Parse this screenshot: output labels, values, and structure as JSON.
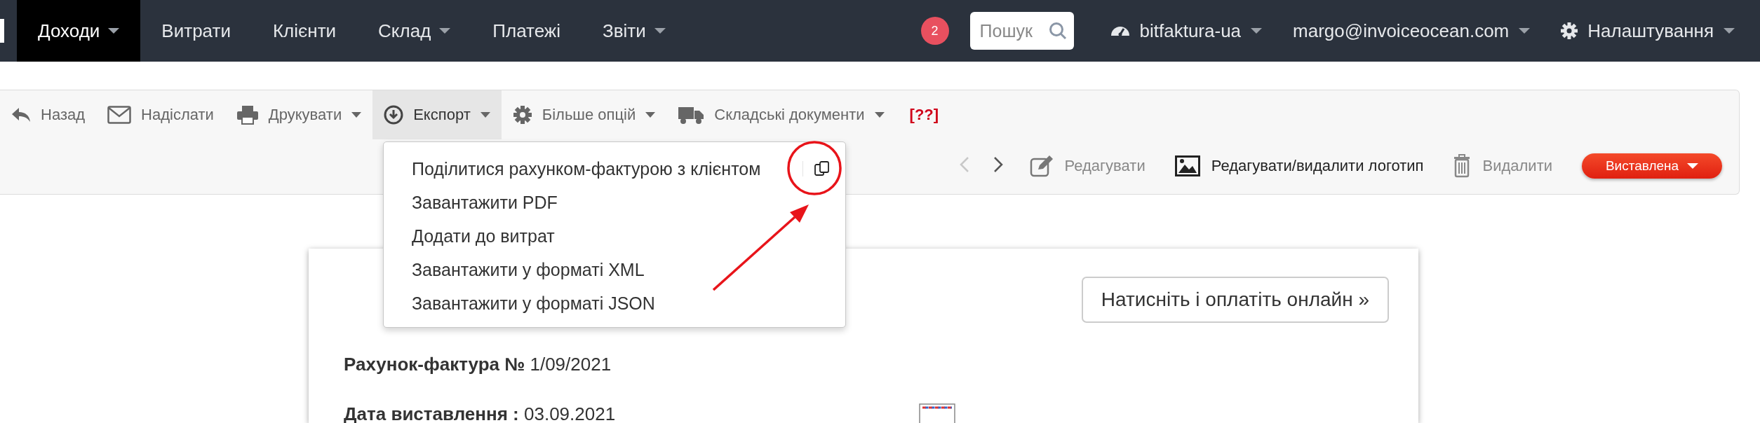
{
  "nav": {
    "items": [
      {
        "label": "Доходи",
        "selected": true,
        "dropdown": true
      },
      {
        "label": "Витрати",
        "selected": false,
        "dropdown": false
      },
      {
        "label": "Клієнти",
        "selected": false,
        "dropdown": false
      },
      {
        "label": "Склад",
        "selected": false,
        "dropdown": true
      },
      {
        "label": "Платежі",
        "selected": false,
        "dropdown": false
      },
      {
        "label": "Звіти",
        "selected": false,
        "dropdown": true
      }
    ],
    "notifications": "2",
    "search": {
      "placeholder": "Пошук"
    },
    "account": "bitfaktura-ua",
    "user": "margo@invoiceocean.com",
    "settings": "Налаштування"
  },
  "toolbar": {
    "actions": [
      {
        "kind": "back",
        "label": "Назад",
        "dropdown": false,
        "selected": false
      },
      {
        "kind": "send",
        "label": "Надіслати",
        "dropdown": false,
        "selected": false
      },
      {
        "kind": "print",
        "label": "Друкувати",
        "dropdown": true,
        "selected": false
      },
      {
        "kind": "export",
        "label": "Експорт",
        "dropdown": true,
        "selected": true
      },
      {
        "kind": "options",
        "label": "Більше опцій",
        "dropdown": true,
        "selected": false
      },
      {
        "kind": "warehouse",
        "label": "Складські документи",
        "dropdown": true,
        "selected": false
      }
    ],
    "missing": "[??]",
    "pager": {
      "prev_disabled": true,
      "next_disabled": false
    },
    "actions2": [
      {
        "kind": "edit",
        "label": "Редагувати",
        "muted": true
      },
      {
        "kind": "logo",
        "label": "Редагувати/видалити логотип",
        "muted": false
      },
      {
        "kind": "delete",
        "label": "Видалити",
        "muted": true
      }
    ],
    "status": "Виставлена"
  },
  "export_menu": {
    "items": [
      {
        "label": "Поділитися рахунком-фактурою з клієнтом",
        "copy": true
      },
      {
        "label": "Завантажити PDF",
        "copy": false
      },
      {
        "label": "Додати до витрат",
        "copy": false
      },
      {
        "label": "Завантажити у форматі XML",
        "copy": false
      },
      {
        "label": "Завантажити у форматі JSON",
        "copy": false
      }
    ]
  },
  "document": {
    "pay_button": "Натисніть і оплатіть онлайн »",
    "number": "**Рахунок-фактура №** 1/09/2021",
    "date": "**Дата виставлення :** 03.09.2021"
  }
}
